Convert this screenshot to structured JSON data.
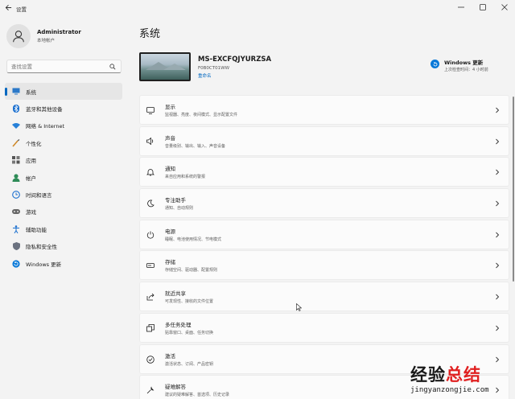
{
  "window": {
    "title": "设置",
    "back_icon": "back-arrow-icon",
    "controls": [
      "minimize-icon",
      "maximize-icon",
      "close-icon"
    ]
  },
  "user": {
    "name": "Administrator",
    "account_type": "本地帐户"
  },
  "search": {
    "placeholder": "查找设置"
  },
  "sidebar": {
    "items": [
      {
        "label": "系统",
        "icon": "system-icon",
        "active": true
      },
      {
        "label": "蓝牙和其他设备",
        "icon": "bluetooth-icon"
      },
      {
        "label": "网络 & Internet",
        "icon": "network-icon"
      },
      {
        "label": "个性化",
        "icon": "personalization-icon"
      },
      {
        "label": "应用",
        "icon": "apps-icon"
      },
      {
        "label": "帐户",
        "icon": "accounts-icon"
      },
      {
        "label": "时间和语言",
        "icon": "time-language-icon"
      },
      {
        "label": "游戏",
        "icon": "gaming-icon"
      },
      {
        "label": "辅助功能",
        "icon": "accessibility-icon"
      },
      {
        "label": "隐私和安全性",
        "icon": "privacy-icon"
      },
      {
        "label": "Windows 更新",
        "icon": "windows-update-icon"
      }
    ]
  },
  "main": {
    "title": "系统",
    "device": {
      "name": "MS-EXCFQJYURZSA",
      "model": "F0B0CT01WW",
      "rename_label": "重命名"
    },
    "update": {
      "title": "Windows 更新",
      "subtitle": "上次检查时间：4 小时前"
    },
    "cards": [
      {
        "title": "显示",
        "subtitle": "监视器、亮度、夜间模式、显示配置文件",
        "icon": "display-icon"
      },
      {
        "title": "声音",
        "subtitle": "音量级别、输出、输入、声音设备",
        "icon": "sound-icon"
      },
      {
        "title": "通知",
        "subtitle": "来自应用和系统的警报",
        "icon": "notifications-icon"
      },
      {
        "title": "专注助手",
        "subtitle": "通知、自动规则",
        "icon": "focus-assist-icon"
      },
      {
        "title": "电源",
        "subtitle": "睡眠、电池使用情况、节电模式",
        "icon": "power-icon"
      },
      {
        "title": "存储",
        "subtitle": "存储空间、驱动器、配置规则",
        "icon": "storage-icon"
      },
      {
        "title": "就近共享",
        "subtitle": "可发现性、接收的文件位置",
        "icon": "nearby-sharing-icon"
      },
      {
        "title": "多任务处理",
        "subtitle": "贴靠窗口、桌面、任务切换",
        "icon": "multitasking-icon"
      },
      {
        "title": "激活",
        "subtitle": "激活状态、订阅、产品密钥",
        "icon": "activation-icon"
      },
      {
        "title": "疑难解答",
        "subtitle": "建议的疑难解答、首选项、历史记录",
        "icon": "troubleshoot-icon"
      }
    ]
  },
  "watermark": {
    "text_black": "经验",
    "text_red": "总结",
    "url": "jingyanzongjie.com"
  },
  "colors": {
    "accent": "#0067c0",
    "background": "#f3f3f3",
    "card": "#fbfbfb",
    "watermark_red": "#e02020"
  }
}
